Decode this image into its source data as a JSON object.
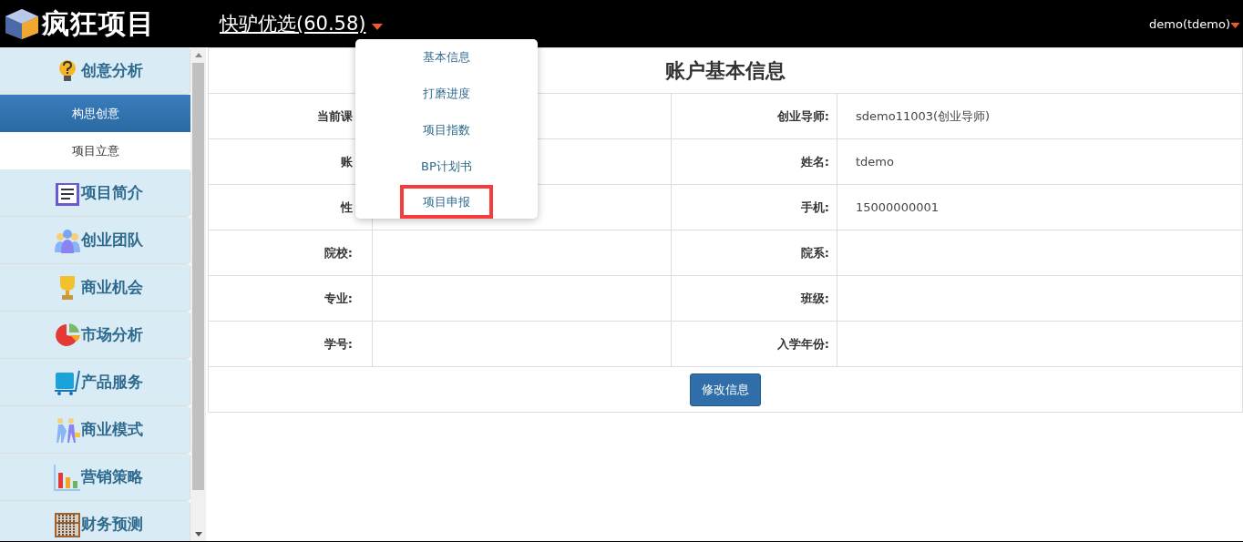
{
  "header": {
    "logo": "疯狂项目",
    "project": "快驴优选(60.58)",
    "user": "demo(tdemo)"
  },
  "sidebar": {
    "items": [
      {
        "label": "创意分析",
        "children": [
          {
            "label": "构思创意",
            "selected": true
          },
          {
            "label": "项目立意",
            "selected": false
          }
        ]
      },
      {
        "label": "项目简介"
      },
      {
        "label": "创业团队"
      },
      {
        "label": "商业机会"
      },
      {
        "label": "市场分析"
      },
      {
        "label": "产品服务"
      },
      {
        "label": "商业模式"
      },
      {
        "label": "营销策略"
      },
      {
        "label": "财务预测"
      }
    ]
  },
  "dropdown": {
    "items": [
      {
        "label": "基本信息",
        "highlighted": false
      },
      {
        "label": "打磨进度",
        "highlighted": false
      },
      {
        "label": "项目指数",
        "highlighted": false
      },
      {
        "label": "BP计划书",
        "highlighted": false
      },
      {
        "label": "项目申报",
        "highlighted": true
      }
    ]
  },
  "form": {
    "title": "账户基本信息",
    "rows": [
      [
        {
          "label": "当前课"
        },
        {
          "label": "创业导师:",
          "value": "sdemo11003(创业导师)"
        }
      ],
      [
        {
          "label": "账"
        },
        {
          "label": "姓名:",
          "value": "tdemo"
        }
      ],
      [
        {
          "label": "性"
        },
        {
          "label": "手机:",
          "value": "15000000001"
        }
      ],
      [
        {
          "label": "院校:"
        },
        {
          "label": "院系:"
        }
      ],
      [
        {
          "label": "专业:"
        },
        {
          "label": "班级:"
        }
      ],
      [
        {
          "label": "学号:"
        },
        {
          "label": "入学年份:"
        }
      ]
    ],
    "button": "修改信息"
  }
}
